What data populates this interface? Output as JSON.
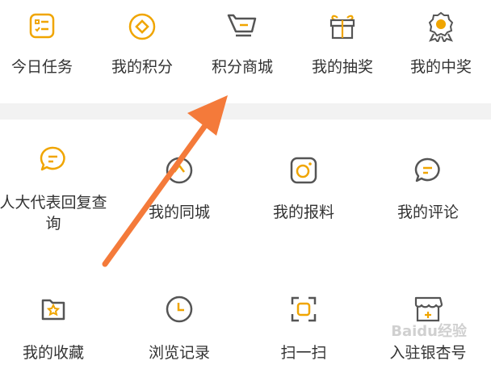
{
  "accent_color": "#f0a500",
  "arrow_color": "#f47a3a",
  "row1": [
    {
      "label": "今日任务",
      "icon": "checklist-icon"
    },
    {
      "label": "我的积分",
      "icon": "points-icon"
    },
    {
      "label": "积分商城",
      "icon": "cart-icon"
    },
    {
      "label": "我的抽奖",
      "icon": "gift-icon"
    },
    {
      "label": "我的中奖",
      "icon": "medal-icon"
    }
  ],
  "row2": [
    {
      "label": "人大代表回复查",
      "label2": "询",
      "icon": "comment-icon"
    },
    {
      "label": "我的同城",
      "icon": "location-icon"
    },
    {
      "label": "我的报料",
      "icon": "camera-icon"
    },
    {
      "label": "我的评论",
      "icon": "comment-icon"
    }
  ],
  "row3": [
    {
      "label": "我的收藏",
      "icon": "star-folder-icon"
    },
    {
      "label": "浏览记录",
      "icon": "clock-icon"
    },
    {
      "label": "扫一扫",
      "icon": "scan-icon"
    },
    {
      "label": "入驻银杏号",
      "icon": "store-icon"
    }
  ],
  "watermark": "Baidu经验"
}
